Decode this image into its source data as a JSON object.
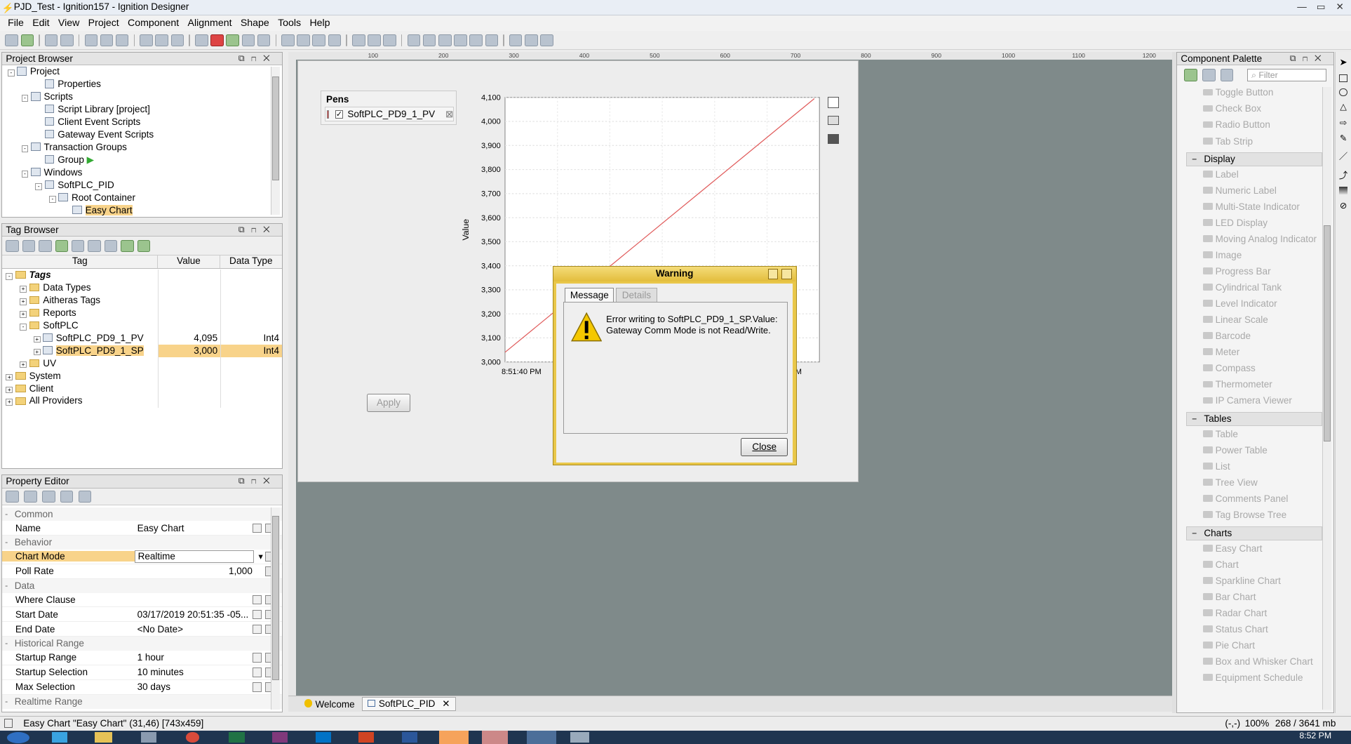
{
  "window": {
    "title": "PJD_Test - Ignition157 - Ignition Designer"
  },
  "menu": [
    "File",
    "Edit",
    "View",
    "Project",
    "Component",
    "Alignment",
    "Shape",
    "Tools",
    "Help"
  ],
  "project_browser": {
    "title": "Project Browser",
    "items": [
      {
        "label": "Project",
        "indent": 0,
        "icon": "project-icon"
      },
      {
        "label": "Properties",
        "indent": 2,
        "icon": "properties-icon"
      },
      {
        "label": "Scripts",
        "indent": 1,
        "icon": "scripts-icon"
      },
      {
        "label": "Script Library [project]",
        "indent": 2,
        "icon": "script-library-icon"
      },
      {
        "label": "Client Event Scripts",
        "indent": 2,
        "icon": "client-scripts-icon"
      },
      {
        "label": "Gateway Event Scripts",
        "indent": 2,
        "icon": "gateway-scripts-icon"
      },
      {
        "label": "Transaction Groups",
        "indent": 1,
        "icon": "transaction-groups-icon"
      },
      {
        "label": "Group",
        "indent": 2,
        "icon": "group-icon"
      },
      {
        "label": "Windows",
        "indent": 1,
        "icon": "windows-icon"
      },
      {
        "label": "SoftPLC_PID",
        "indent": 2,
        "icon": "window-icon"
      },
      {
        "label": "Root Container",
        "indent": 3,
        "icon": "container-icon"
      },
      {
        "label": "Easy Chart",
        "indent": 4,
        "icon": "easy-chart-icon",
        "selected": true
      }
    ]
  },
  "tag_browser": {
    "title": "Tag Browser",
    "columns": [
      "Tag",
      "Value",
      "Data Type"
    ],
    "rows": [
      {
        "tag": "Tags",
        "value": "",
        "type": "",
        "indent": 0,
        "bold": true
      },
      {
        "tag": "Data Types",
        "value": "",
        "type": "",
        "indent": 1
      },
      {
        "tag": "Aitheras Tags",
        "value": "",
        "type": "",
        "indent": 1
      },
      {
        "tag": "Reports",
        "value": "",
        "type": "",
        "indent": 1
      },
      {
        "tag": "SoftPLC",
        "value": "",
        "type": "",
        "indent": 1
      },
      {
        "tag": "SoftPLC_PD9_1_PV",
        "value": "4,095",
        "type": "Int4",
        "indent": 2,
        "tag_icon": true
      },
      {
        "tag": "SoftPLC_PD9_1_SP",
        "value": "3,000",
        "type": "Int4",
        "indent": 2,
        "tag_icon": true,
        "selected": true
      },
      {
        "tag": "UV",
        "value": "",
        "type": "",
        "indent": 1
      },
      {
        "tag": "System",
        "value": "",
        "type": "",
        "indent": 0
      },
      {
        "tag": "Client",
        "value": "",
        "type": "",
        "indent": 0
      },
      {
        "tag": "All Providers",
        "value": "",
        "type": "",
        "indent": 0
      }
    ]
  },
  "property_editor": {
    "title": "Property Editor",
    "rows": [
      {
        "section": "Common"
      },
      {
        "k": "Name",
        "v": "Easy Chart"
      },
      {
        "section": "Behavior"
      },
      {
        "k": "Chart Mode",
        "v": "Realtime",
        "selected": true,
        "dropdown": true
      },
      {
        "k": "Poll Rate",
        "v": "1,000",
        "right": true
      },
      {
        "section": "Data"
      },
      {
        "k": "Where Clause",
        "v": ""
      },
      {
        "k": "Start Date",
        "v": "03/17/2019 20:51:35 -05..."
      },
      {
        "k": "End Date",
        "v": "<No Date>"
      },
      {
        "section": "Historical Range"
      },
      {
        "k": "Startup Range",
        "v": "1 hour"
      },
      {
        "k": "Startup Selection",
        "v": "10 minutes"
      },
      {
        "k": "Max Selection",
        "v": "30 days"
      },
      {
        "section": "Realtime Range"
      }
    ]
  },
  "pens": {
    "title": "Pens",
    "pen": "SoftPLC_PD9_1_PV",
    "pen_color": "#e34a4a"
  },
  "chart_data": {
    "type": "line",
    "ylabel": "Value",
    "ylim": [
      3000,
      4100
    ],
    "yticks": [
      "4,100",
      "4,000",
      "3,900",
      "3,800",
      "3,700",
      "3,600",
      "3,500",
      "3,400",
      "3,300",
      "3,200",
      "3,100",
      "3,000"
    ],
    "xticks": [
      "8:51:40 PM"
    ],
    "series": [
      {
        "name": "SoftPLC_PD9_1_PV",
        "color": "#e05a5a",
        "x": [
          0,
          1
        ],
        "y": [
          3040,
          4095
        ]
      }
    ],
    "x_end_label_fragment": "M"
  },
  "apply_button": "Apply",
  "dialog": {
    "title": "Warning",
    "tabs": [
      "Message",
      "Details"
    ],
    "message_line1": "Error writing to SoftPLC_PD9_1_SP.Value:",
    "message_line2": "Gateway Comm Mode is not Read/Write.",
    "close": "Close"
  },
  "document_tabs": [
    "Welcome",
    "SoftPLC_PID"
  ],
  "palette": {
    "title": "Component Palette",
    "filter_placeholder": "Filter",
    "top_items": [
      "Toggle Button",
      "Check Box",
      "Radio Button",
      "Tab Strip"
    ],
    "sections": [
      {
        "name": "Display",
        "items": [
          "Label",
          "Numeric Label",
          "Multi-State Indicator",
          "LED Display",
          "Moving Analog Indicator",
          "Image",
          "Progress Bar",
          "Cylindrical Tank",
          "Level Indicator",
          "Linear Scale",
          "Barcode",
          "Meter",
          "Compass",
          "Thermometer",
          "IP Camera Viewer"
        ]
      },
      {
        "name": "Tables",
        "items": [
          "Table",
          "Power Table",
          "List",
          "Tree View",
          "Comments Panel",
          "Tag Browse Tree"
        ]
      },
      {
        "name": "Charts",
        "items": [
          "Easy Chart",
          "Chart",
          "Sparkline Chart",
          "Bar Chart",
          "Radar Chart",
          "Status Chart",
          "Pie Chart",
          "Box and Whisker Chart",
          "Equipment Schedule"
        ]
      }
    ]
  },
  "status": {
    "left": "Easy Chart \"Easy Chart\" (31,46) [743x459]",
    "coords": "(-,-)",
    "zoom": "100%",
    "memory": "268 / 3641 mb"
  },
  "ruler_labels": [
    "100",
    "200",
    "300",
    "400",
    "500",
    "600",
    "700",
    "800",
    "900",
    "1000",
    "1100",
    "1200"
  ],
  "taskbar": {
    "time": "8:52 PM"
  }
}
